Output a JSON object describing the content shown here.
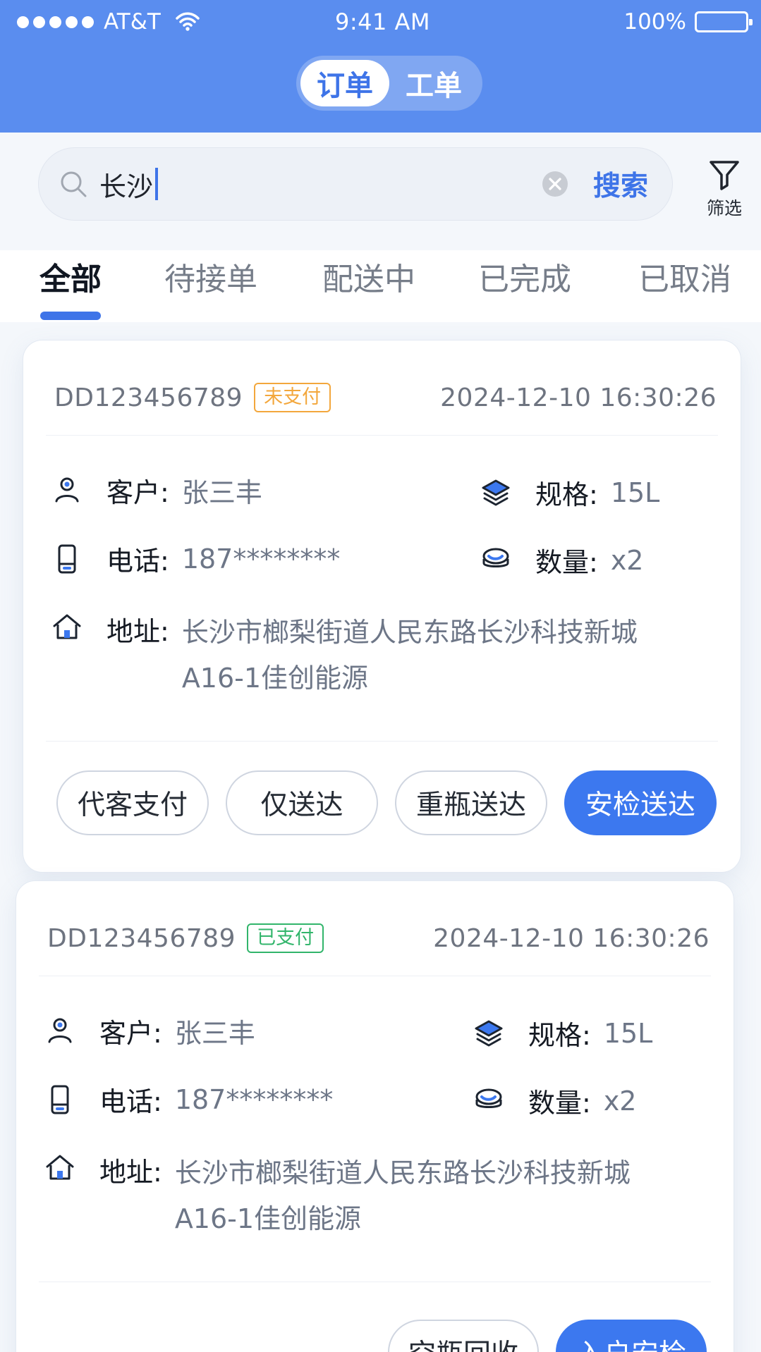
{
  "status_bar": {
    "carrier": "AT&T",
    "time": "9:41 AM",
    "battery": "100%"
  },
  "header": {
    "segments": [
      {
        "label": "订单",
        "active": true
      },
      {
        "label": "工单",
        "active": false
      }
    ]
  },
  "search": {
    "value": "长沙",
    "button": "搜索",
    "filter": "筛选",
    "icon": "search-icon"
  },
  "tabs": [
    {
      "label": "全部",
      "active": true
    },
    {
      "label": "待接单",
      "active": false
    },
    {
      "label": "配送中",
      "active": false
    },
    {
      "label": "已完成",
      "active": false
    },
    {
      "label": "已取消",
      "active": false
    }
  ],
  "orders": [
    {
      "order_no": "DD123456789",
      "status": "未支付",
      "datetime": "2024-12-10 16:30:26",
      "customer_label": "客户:",
      "customer": "张三丰",
      "phone_label": "电话:",
      "phone": "187********",
      "address_label": "地址:",
      "address": "长沙市榔梨街道人民东路长沙科技新城A16-1佳创能源",
      "spec_label": "规格:",
      "spec": "15L",
      "qty_label": "数量:",
      "qty": "x2",
      "actions": [
        "代客支付",
        "仅送达",
        "重瓶送达",
        "安检送达"
      ]
    },
    {
      "order_no": "DD123456789",
      "status": "已支付",
      "datetime": "2024-12-10 16:30:26",
      "customer_label": "客户:",
      "customer": "张三丰",
      "phone_label": "电话:",
      "phone": "187********",
      "address_label": "地址:",
      "address": "长沙市榔梨街道人民东路长沙科技新城A16-1佳创能源",
      "spec_label": "规格:",
      "spec": "15L",
      "qty_label": "数量:",
      "qty": "x2",
      "actions": [
        "空瓶回收",
        "入户安检"
      ]
    }
  ],
  "colors": {
    "primary": "#3c78ef",
    "header": "#5a8def",
    "unpaid": "#f3a73c",
    "paid": "#32b56b"
  }
}
